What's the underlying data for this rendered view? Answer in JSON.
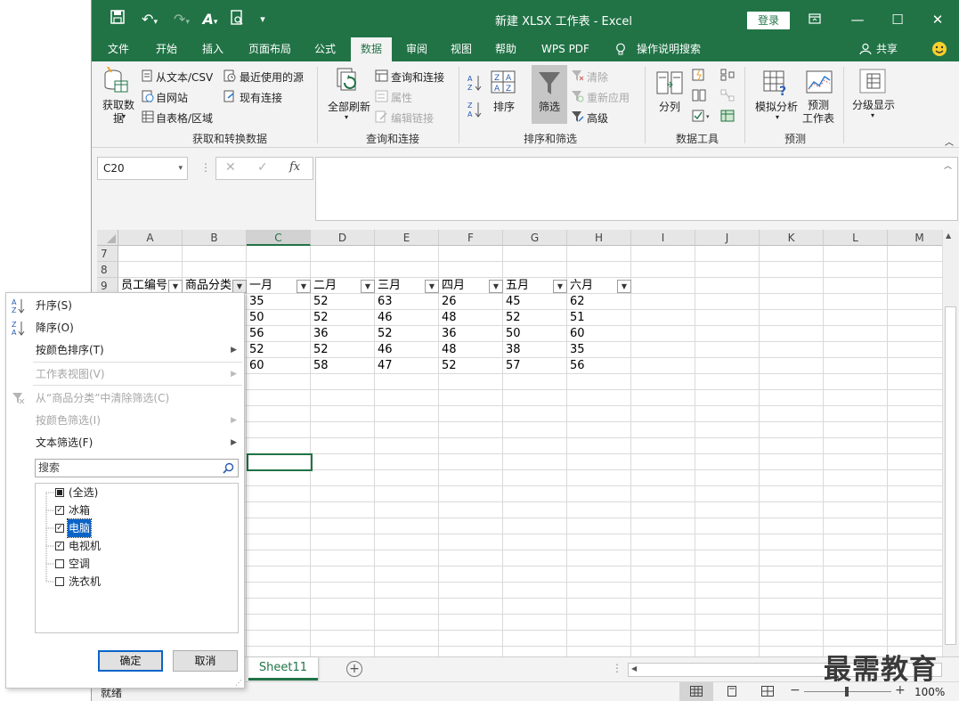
{
  "title_bar": {
    "window_title": "新建 XLSX 工作表 - Excel",
    "login": "登录"
  },
  "tabs": [
    "文件",
    "开始",
    "插入",
    "页面布局",
    "公式",
    "数据",
    "审阅",
    "视图",
    "帮助",
    "WPS PDF",
    "操作说明搜索"
  ],
  "share": "共享",
  "ribbon": {
    "get_data": "获取数\n据",
    "from_text_csv": "从文本/CSV",
    "recent_sources": "最近使用的源",
    "from_web": "自网站",
    "existing_connections": "现有连接",
    "from_table": "自表格/区域",
    "group_get_transform": "获取和转换数据",
    "refresh_all": "全部刷新",
    "queries_connections": "查询和连接",
    "properties": "属性",
    "edit_links": "编辑链接",
    "group_queries": "查询和连接",
    "sort": "排序",
    "filter": "筛选",
    "clear": "清除",
    "reapply": "重新应用",
    "advanced": "高级",
    "group_sort_filter": "排序和筛选",
    "text_to_columns": "分列",
    "group_data_tools": "数据工具",
    "what_if": "模拟分析",
    "forecast_sheet": "预测\n工作表",
    "group_forecast": "预测",
    "outline": "分级显示"
  },
  "name_box": "C20",
  "grid": {
    "columns": [
      "A",
      "B",
      "C",
      "D",
      "E",
      "F",
      "G",
      "H",
      "I",
      "J",
      "K",
      "L",
      "M"
    ],
    "rows": [
      "7",
      "8",
      "9"
    ],
    "headers": [
      "员工编号",
      "商品分类",
      "一月",
      "二月",
      "三月",
      "四月",
      "五月",
      "六月"
    ],
    "data": [
      [
        "35",
        "52",
        "63",
        "26",
        "45",
        "62"
      ],
      [
        "50",
        "52",
        "46",
        "48",
        "52",
        "51"
      ],
      [
        "56",
        "36",
        "52",
        "36",
        "50",
        "60"
      ],
      [
        "52",
        "52",
        "46",
        "48",
        "38",
        "35"
      ],
      [
        "60",
        "58",
        "47",
        "52",
        "57",
        "56"
      ]
    ]
  },
  "filter_menu": {
    "sort_asc": "升序(S)",
    "sort_desc": "降序(O)",
    "sort_by_color": "按颜色排序(T)",
    "sheet_view": "工作表视图(V)",
    "clear_filter": "从“商品分类”中清除筛选(C)",
    "filter_by_color": "按颜色筛选(I)",
    "text_filter": "文本筛选(F)",
    "search_placeholder": "搜索",
    "items": [
      {
        "label": "(全选)",
        "state": "partial"
      },
      {
        "label": "冰箱",
        "state": "checked"
      },
      {
        "label": "电脑",
        "state": "checked"
      },
      {
        "label": "电视机",
        "state": "checked"
      },
      {
        "label": "空调",
        "state": "unchecked"
      },
      {
        "label": "洗衣机",
        "state": "unchecked"
      }
    ],
    "ok": "确定",
    "cancel": "取消"
  },
  "sheet_tab": "Sheet11",
  "status": {
    "ready": "就绪",
    "zoom": "100%"
  },
  "watermark": "最需教育",
  "accent_color": "#217346"
}
